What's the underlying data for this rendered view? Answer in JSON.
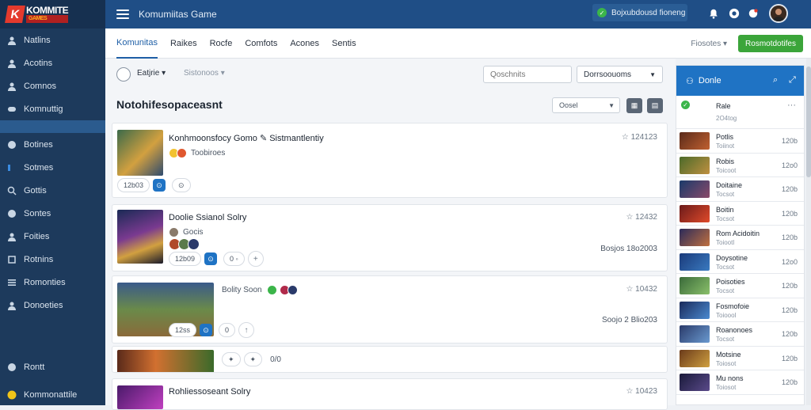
{
  "app": {
    "logo_text": "KOMMITE",
    "logo_sub": "GAMES",
    "logo_letter": "K",
    "title": "Komumiitas Game"
  },
  "status": {
    "label": "Bojxubdousd fioneng"
  },
  "colors": {
    "sidebar": "#1d3a5c",
    "topbar": "#1f4e86",
    "accent": "#1f73c4",
    "primary": "#3ba53a"
  },
  "sidebar": {
    "items": [
      {
        "label": "Natlins",
        "icon": "user-icon"
      },
      {
        "label": "Acotins",
        "icon": "user-icon"
      },
      {
        "label": "Comnos",
        "icon": "user-icon"
      },
      {
        "label": "Komnuttig",
        "icon": "gamepad-icon"
      }
    ],
    "items2": [
      {
        "label": "Botines",
        "icon": "circle-icon"
      },
      {
        "label": "Sotmes",
        "icon": "square-icon"
      },
      {
        "label": "Gottis",
        "icon": "search-icon"
      },
      {
        "label": "Sontes",
        "icon": "circle-icon"
      },
      {
        "label": "Foities",
        "icon": "user-icon"
      },
      {
        "label": "Rotnins",
        "icon": "box-icon"
      },
      {
        "label": "Romonties",
        "icon": "list-icon"
      },
      {
        "label": "Donoeties",
        "icon": "user-icon"
      }
    ],
    "bottom": [
      {
        "label": "Rontt",
        "icon": "circle-icon"
      },
      {
        "label": "Kommonattile",
        "icon": "coin-icon"
      }
    ]
  },
  "tabs": [
    {
      "label": "Komunitas",
      "active": true
    },
    {
      "label": "Raikes"
    },
    {
      "label": "Rocfe"
    },
    {
      "label": "Comfots"
    },
    {
      "label": "Acones"
    },
    {
      "label": "Sentis"
    }
  ],
  "tabs_right": {
    "label": "Fiosotes ▾"
  },
  "primary_button": {
    "label": "Rosmotdotifes"
  },
  "filter": {
    "dropdown1": "Eatjrie",
    "dropdown2": "Sistonoos",
    "search_placeholder": "Qoschnits",
    "select_value": "Dorrsoouoms"
  },
  "section": {
    "title": "Notohifesopaceasnt",
    "sort_value": "Oosel"
  },
  "posts": [
    {
      "title": "Konhmoonsfocy Gomo ✎ Sistmantlentiy",
      "meta": "☆ 124123",
      "tags": "Toobiroes",
      "chip1": "12b03",
      "chip2": "⊙"
    },
    {
      "title": "Doolie Ssianol Solry",
      "meta": "☆ 12432",
      "tags": "Gocis",
      "chip1": "12b09",
      "chip2": "0 ◦",
      "right_sub": "Bosjos 18o2003"
    },
    {
      "title": "",
      "meta": "☆ 10432",
      "tags": "Bolity  Soon",
      "chip1": "12ss",
      "chip2": "0",
      "right_sub": "Soojo 2 Blio203"
    },
    {
      "title": "",
      "meta": "",
      "tags": "",
      "chip1": "✦",
      "chip2": "✦",
      "chip3": "0/0"
    },
    {
      "title": "Rohliessoseant Solry",
      "meta": "☆ 10423",
      "tags": ""
    }
  ],
  "right_panel": {
    "title": "Donle",
    "first": {
      "name": "Rale",
      "sub": "2O4tog"
    },
    "items": [
      {
        "name": "Potlis",
        "sub": "Toiinot",
        "val": "120b"
      },
      {
        "name": "Robis",
        "sub": "Toicoot",
        "val": "12o0"
      },
      {
        "name": "Doitaine",
        "sub": "Tocsot",
        "val": "120b"
      },
      {
        "name": "Boitin",
        "sub": "Tocsot",
        "val": "120b"
      },
      {
        "name": "Rom Acidoitin",
        "sub": "Toiootl",
        "val": "120b"
      },
      {
        "name": "Doysotine",
        "sub": "Tocsot",
        "val": "12o0"
      },
      {
        "name": "Poisoties",
        "sub": "Tocsot",
        "val": "120b"
      },
      {
        "name": "Fosmofoie",
        "sub": "Toioool",
        "val": "120b"
      },
      {
        "name": "Roanonoes",
        "sub": "Tocsot",
        "val": "120b"
      },
      {
        "name": "Motsine",
        "sub": "Toiosot",
        "val": "120b"
      },
      {
        "name": "Mu nons",
        "sub": "Toiosot",
        "val": "120b"
      }
    ]
  }
}
